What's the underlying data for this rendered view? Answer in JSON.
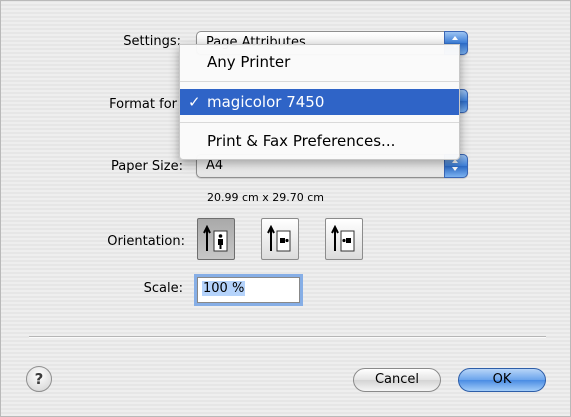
{
  "settings": {
    "label": "Settings:",
    "value": "Page Attributes"
  },
  "format_for": {
    "label": "Format for",
    "value": "magicolor 7450"
  },
  "paper_size": {
    "label": "Paper Size:",
    "value": "A4",
    "dimensions": "20.99 cm x 29.70 cm"
  },
  "orientation": {
    "label": "Orientation:",
    "options": [
      {
        "icon": "portrait-orientation-icon",
        "selected": true
      },
      {
        "icon": "landscape-left-orientation-icon",
        "selected": false
      },
      {
        "icon": "landscape-right-orientation-icon",
        "selected": false
      }
    ]
  },
  "scale": {
    "label": "Scale:",
    "value": "100 %"
  },
  "help": {
    "label": "?"
  },
  "buttons": {
    "cancel": "Cancel",
    "ok": "OK"
  },
  "menu": {
    "items": [
      {
        "label": "Any Printer",
        "selected": false
      },
      {
        "label": "magicolor 7450",
        "selected": true,
        "check": "✓"
      },
      {
        "label": "Print & Fax Preferences...",
        "selected": false
      }
    ]
  },
  "colors": {
    "menu_highlight": "#2f64c7",
    "ok_button": "#4a8ce4",
    "focus_ring": "#86aee6"
  }
}
